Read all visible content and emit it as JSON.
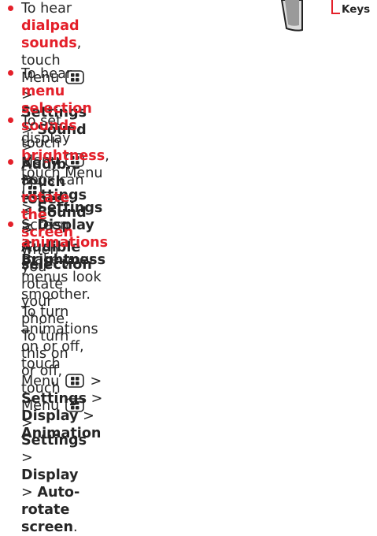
{
  "callout": {
    "label": "Keys"
  },
  "bullets": [
    {
      "lines": [
        [
          "To hear ",
          {
            "hl": "dialpad sounds"
          },
          ", touch"
        ],
        [
          "Menu ",
          {
            "icon": "menu-key-icon"
          },
          " > ",
          {
            "b": "Settings"
          },
          " > ",
          {
            "b": "Sound"
          },
          " >"
        ],
        [
          {
            "b": "Audible touch tones"
          },
          "."
        ]
      ]
    },
    {
      "lines": [
        [
          "To hear ",
          {
            "hl": "menu selection sounds"
          },
          ", touch Menu ",
          {
            "icon": "menu-key-icon"
          }
        ],
        [
          "> ",
          {
            "b": "Settings"
          },
          " > ",
          {
            "b": "Sound"
          },
          " > ",
          {
            "b": "Audible selection"
          }
        ]
      ]
    },
    {
      "lines": [
        [
          "To set display ",
          {
            "hl": "brightness"
          },
          ", touch Menu ",
          {
            "icon": "menu-key-icon"
          }
        ],
        [
          "> ",
          {
            "b": "Settings"
          },
          " > ",
          {
            "b": "Display"
          },
          " > ",
          {
            "b": "Brightness"
          }
        ]
      ]
    },
    {
      "lines": [
        [
          "Many apps can ",
          {
            "hl": "rotate the screen"
          },
          " when you rotate"
        ],
        [
          "your phone. To turn this on or off, touch Menu ",
          {
            "icon": "menu-key-icon"
          }
        ],
        [
          "> ",
          {
            "b": "Settings"
          },
          " > ",
          {
            "b": "Display"
          },
          " > ",
          {
            "b": "Auto-rotate screen"
          },
          "."
        ]
      ]
    },
    {
      "lines": [
        [
          "Screen ",
          {
            "hl": "animations"
          },
          " make your menus look"
        ],
        [
          "smoother. To turn animations on or off, touch"
        ],
        [
          "Menu ",
          {
            "icon": "menu-key-icon"
          },
          " > ",
          {
            "b": "Settings"
          },
          " > ",
          {
            "b": "Display"
          },
          " > ",
          {
            "b": "Animation"
          }
        ]
      ]
    }
  ],
  "colors": {
    "highlight": "#e4202a",
    "text": "#262626"
  }
}
